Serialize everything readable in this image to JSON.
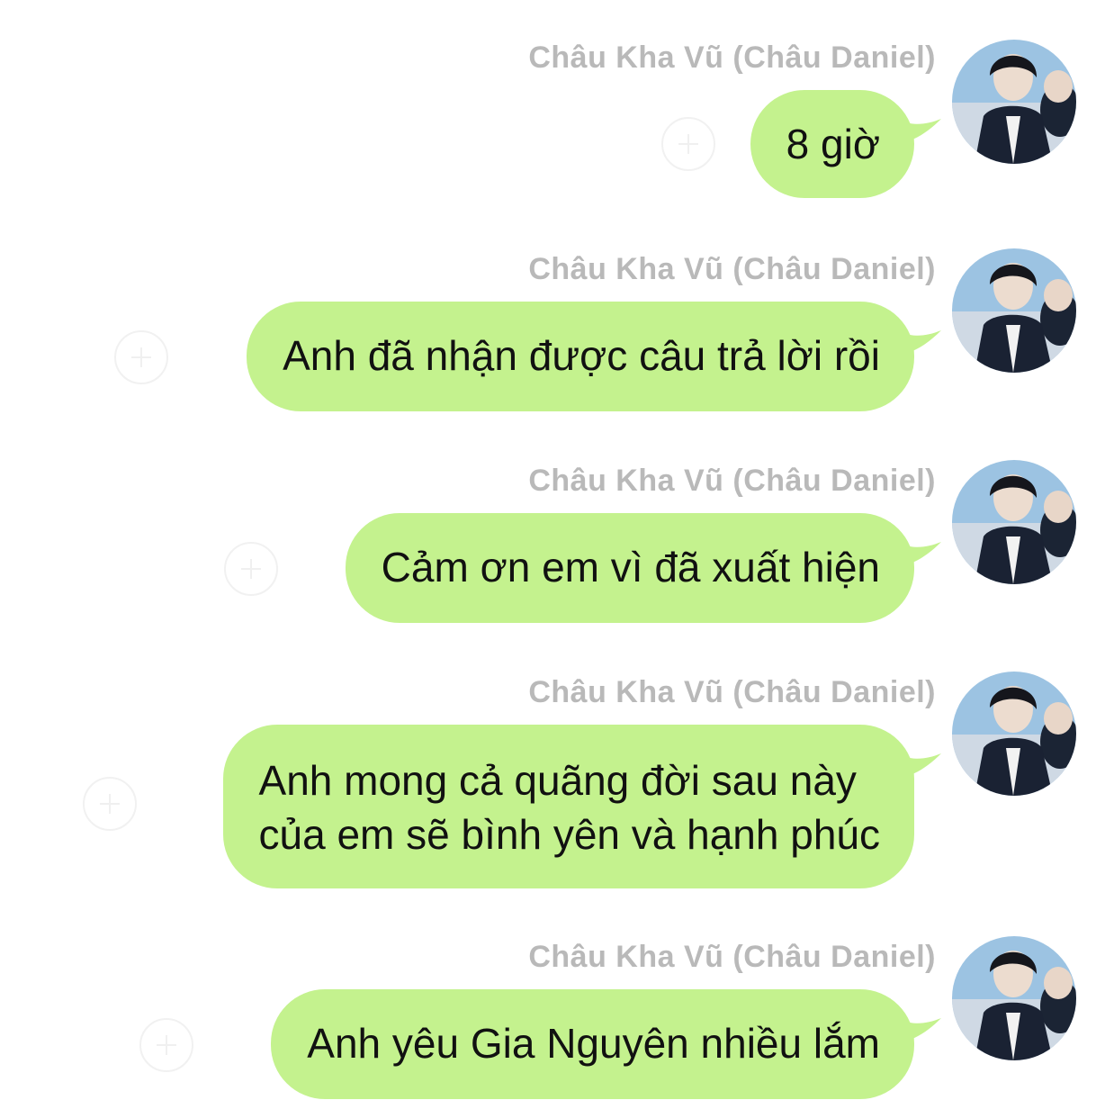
{
  "chat": {
    "messages": [
      {
        "sender": "Châu Kha Vũ (Châu Daniel)",
        "lines": [
          "8 giờ"
        ],
        "avatar_icon": "user-avatar-photo",
        "add_icon": "plus-circle-icon"
      },
      {
        "sender": "Châu Kha Vũ (Châu Daniel)",
        "lines": [
          "Anh đã nhận được câu trả lời rồi"
        ],
        "avatar_icon": "user-avatar-photo",
        "add_icon": "plus-circle-icon"
      },
      {
        "sender": "Châu Kha Vũ (Châu Daniel)",
        "lines": [
          "Cảm ơn em vì đã xuất hiện"
        ],
        "avatar_icon": "user-avatar-photo",
        "add_icon": "plus-circle-icon"
      },
      {
        "sender": "Châu Kha Vũ (Châu Daniel)",
        "lines": [
          "Anh mong cả quãng đời sau này",
          "của em sẽ bình yên và hạnh phúc"
        ],
        "avatar_icon": "user-avatar-photo",
        "add_icon": "plus-circle-icon"
      },
      {
        "sender": "Châu Kha Vũ (Châu Daniel)",
        "lines": [
          "Anh yêu Gia Nguyên nhiều lắm"
        ],
        "avatar_icon": "user-avatar-photo",
        "add_icon": "plus-circle-icon"
      }
    ]
  },
  "colors": {
    "bubble": "#c4f28e",
    "sender_name": "#b9b9b9",
    "message_text": "#111111",
    "background": "#ffffff"
  }
}
